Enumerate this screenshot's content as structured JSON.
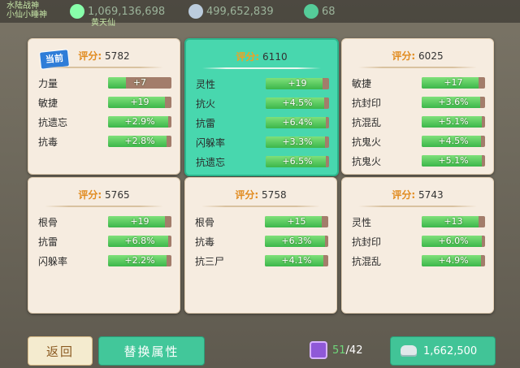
{
  "top": {
    "label_left": "水陆战神",
    "label_left2": "小仙小睡神",
    "label_mid": "黄天仙",
    "res1": "1,069,136,698",
    "res2": "499,652,839",
    "res3": "68"
  },
  "cards": [
    {
      "score_label": "评分:",
      "score": "5782",
      "badge": "当前",
      "rows": [
        {
          "name": "力量",
          "val": "+7",
          "fill": 0.28
        },
        {
          "name": "敏捷",
          "val": "+19",
          "fill": 0.9
        },
        {
          "name": "抗遗忘",
          "val": "+2.9%",
          "fill": 0.95
        },
        {
          "name": "抗毒",
          "val": "+2.8%",
          "fill": 0.92
        }
      ]
    },
    {
      "score_label": "评分:",
      "score": "6110",
      "rows": [
        {
          "name": "灵性",
          "val": "+19",
          "fill": 0.9
        },
        {
          "name": "抗火",
          "val": "+4.5%",
          "fill": 0.92
        },
        {
          "name": "抗雷",
          "val": "+6.4%",
          "fill": 0.95
        },
        {
          "name": "闪躲率",
          "val": "+3.3%",
          "fill": 0.93
        },
        {
          "name": "抗遗忘",
          "val": "+6.5%",
          "fill": 0.95
        }
      ]
    },
    {
      "score_label": "评分:",
      "score": "6025",
      "rows": [
        {
          "name": "敏捷",
          "val": "+17",
          "fill": 0.9
        },
        {
          "name": "抗封印",
          "val": "+3.6%",
          "fill": 0.92
        },
        {
          "name": "抗混乱",
          "val": "+5.1%",
          "fill": 0.95
        },
        {
          "name": "抗鬼火",
          "val": "+4.5%",
          "fill": 0.93
        },
        {
          "name": "抗鬼火",
          "val": "+5.1%",
          "fill": 0.95
        }
      ]
    },
    {
      "score_label": "评分:",
      "score": "5765",
      "rows": [
        {
          "name": "根骨",
          "val": "+19",
          "fill": 0.9
        },
        {
          "name": "抗雷",
          "val": "+6.8%",
          "fill": 0.95
        },
        {
          "name": "闪躲率",
          "val": "+2.2%",
          "fill": 0.92
        }
      ]
    },
    {
      "score_label": "评分:",
      "score": "5758",
      "rows": [
        {
          "name": "根骨",
          "val": "+15",
          "fill": 0.9
        },
        {
          "name": "抗毒",
          "val": "+6.3%",
          "fill": 0.95
        },
        {
          "name": "抗三尸",
          "val": "+4.1%",
          "fill": 0.92
        }
      ]
    },
    {
      "score_label": "评分:",
      "score": "5743",
      "rows": [
        {
          "name": "灵性",
          "val": "+13",
          "fill": 0.9
        },
        {
          "name": "抗封印",
          "val": "+6.0%",
          "fill": 0.95
        },
        {
          "name": "抗混乱",
          "val": "+4.9%",
          "fill": 0.93
        }
      ]
    }
  ],
  "bottom": {
    "back_label": "返回",
    "swap_label": "替换属性",
    "count_current": "51",
    "count_sep": "/42",
    "money": "1,662,500"
  },
  "colors": {
    "selected": "#48d7ae",
    "card": "#f6ece0",
    "accent": "#e18b1f"
  }
}
